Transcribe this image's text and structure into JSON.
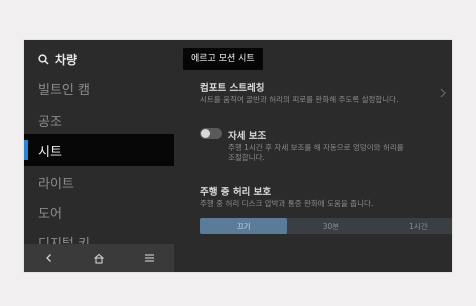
{
  "search": {
    "label": "차량"
  },
  "sidebar": {
    "items": [
      {
        "label": "빌트인 캠"
      },
      {
        "label": "공조"
      },
      {
        "label": "시트"
      },
      {
        "label": "라이트"
      },
      {
        "label": "도어"
      },
      {
        "label": "디지털 키"
      }
    ]
  },
  "tooltip": {
    "text": "에르고 모션 시트"
  },
  "settings": {
    "comfort": {
      "title": "컴포트 스트레칭",
      "desc": "시트를 움직여 골반과 허리의 피로를 완화해 주도록 설정합니다."
    },
    "posture": {
      "title": "자세 보조",
      "desc_line1": "주행 1시간 후 자세 보조를 해 자동으로 엉덩이와 허리를",
      "desc_line2": "조절합니다.",
      "enabled": false
    },
    "lumbar": {
      "title": "주행 중 허리 보호",
      "desc": "주행 중 허리 디스크 압박과 통증 완화에 도움을 줍니다.",
      "options": [
        "끄기",
        "30분",
        "1시간"
      ],
      "selected": "끄기"
    }
  },
  "colors": {
    "accent": "#2a84d6",
    "selected_segment": "#5b7c98"
  },
  "icons": {
    "search": "search-icon",
    "back": "back-icon",
    "home": "home-icon",
    "menu": "menu-icon",
    "chevron": "chevron-right-icon"
  }
}
